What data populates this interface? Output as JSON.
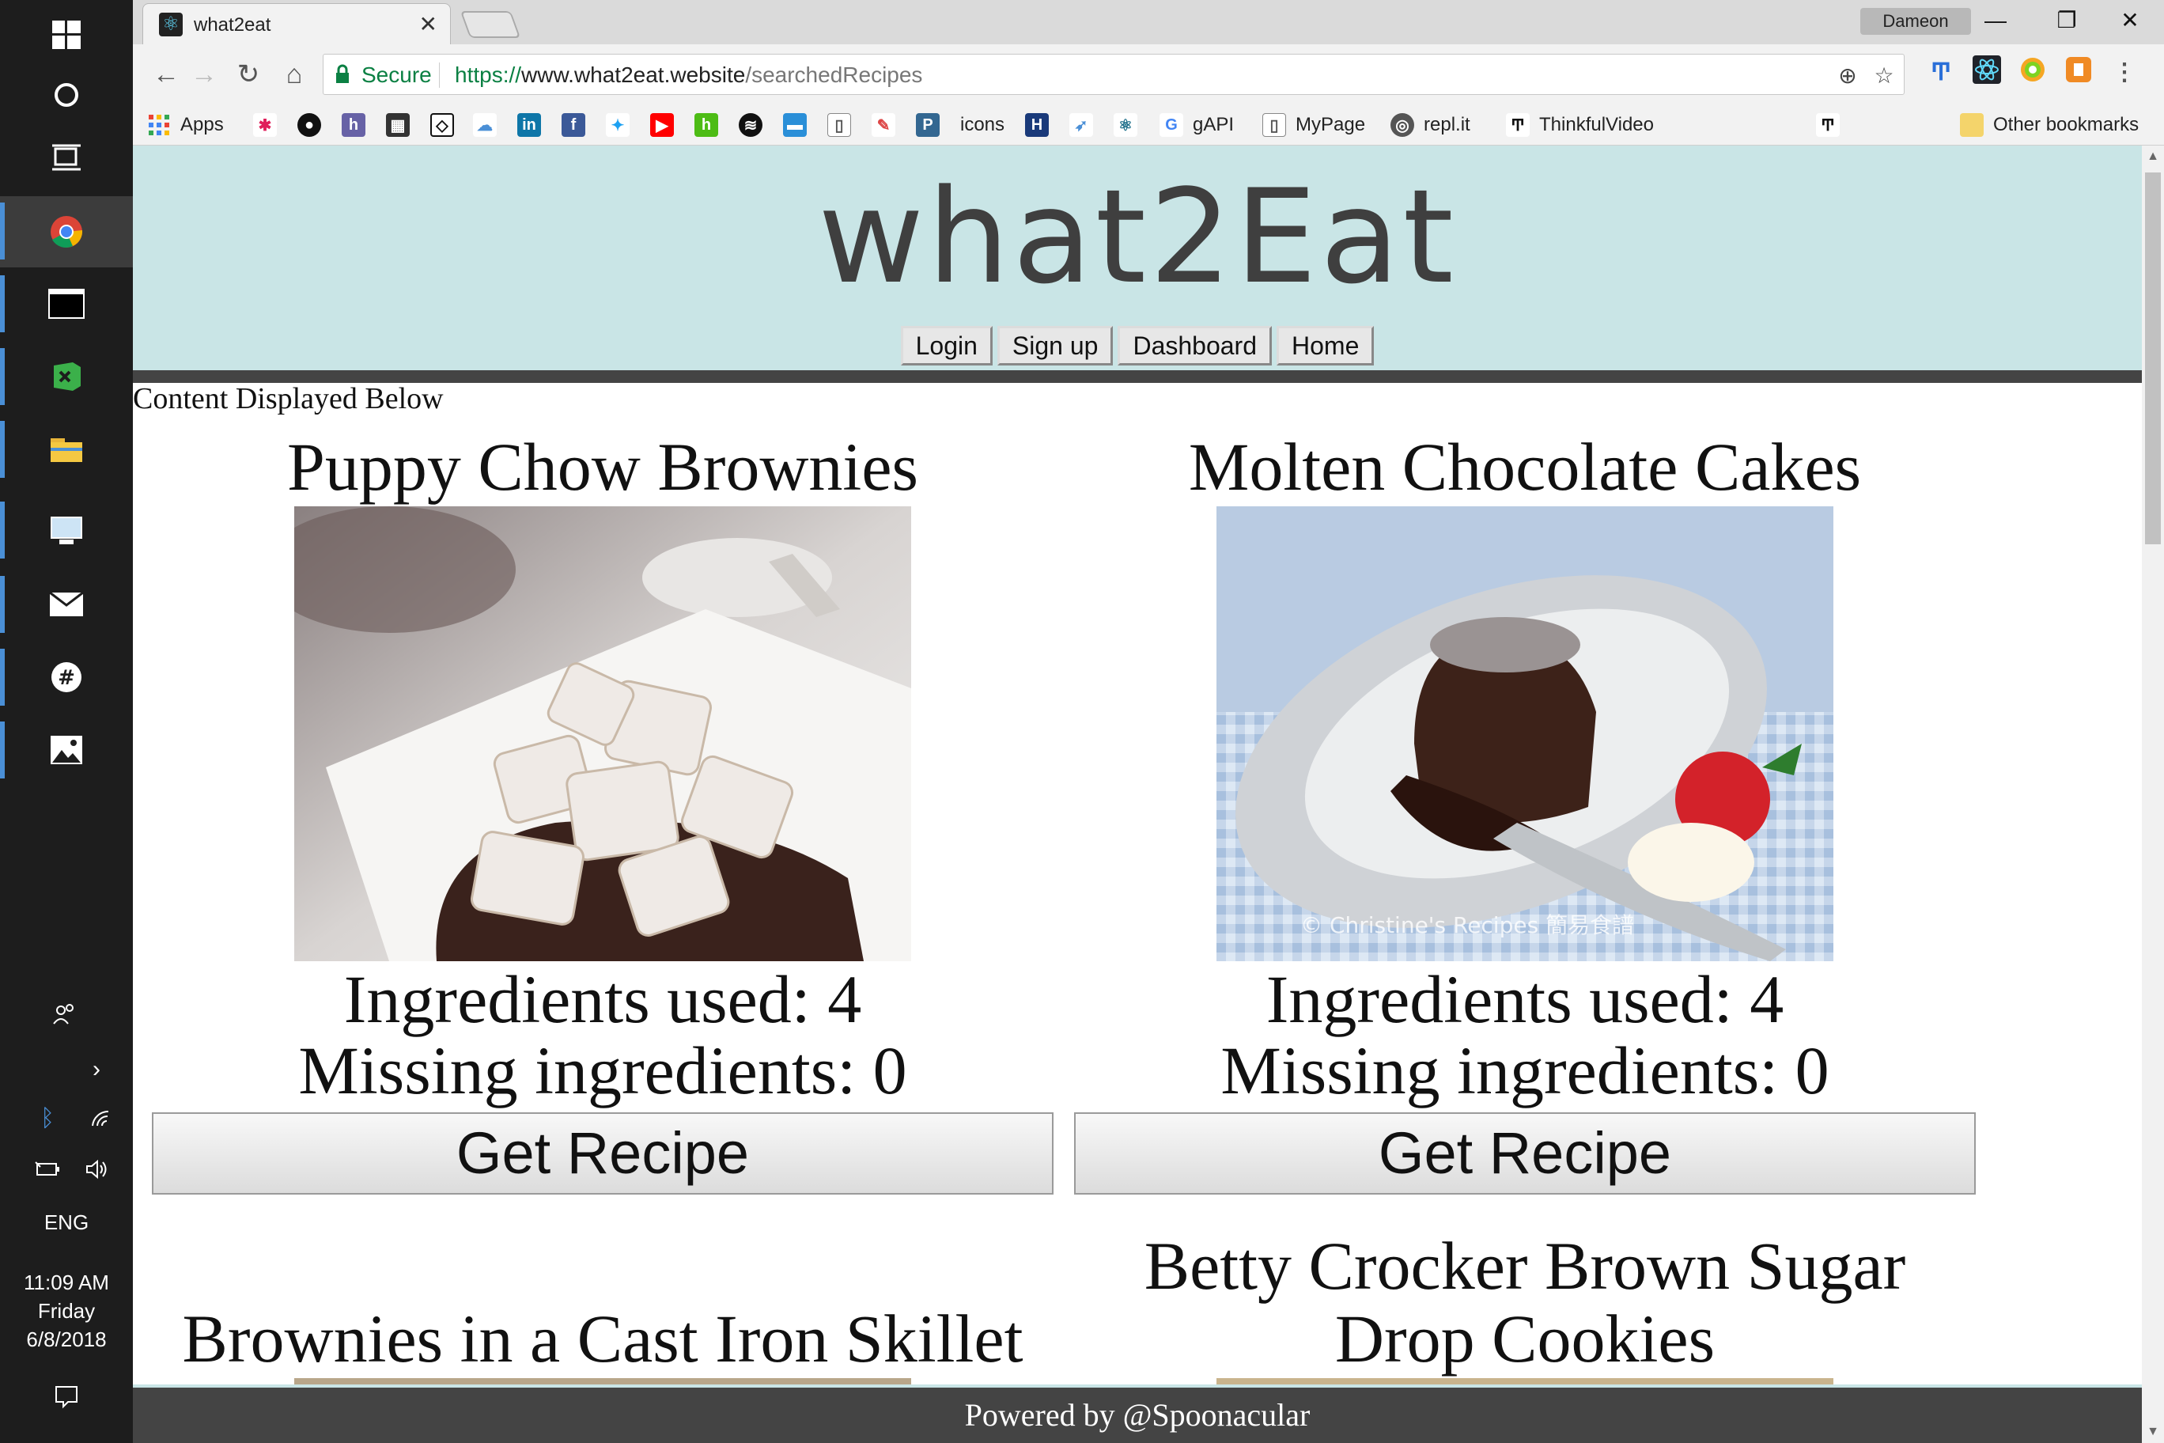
{
  "taskbar": {
    "clock": {
      "time": "11:09 AM",
      "day": "Friday",
      "date": "6/8/2018"
    },
    "language": "ENG"
  },
  "browser": {
    "tab_title": "what2eat",
    "profile_name": "Dameon",
    "secure_label": "Secure",
    "url": {
      "protocol": "https://",
      "host": "www.what2eat.website",
      "path": "/searchedRecipes"
    }
  },
  "bookmarks": {
    "apps": "Apps",
    "icons": "icons",
    "gapi": "gAPI",
    "mypage": "MyPage",
    "replit": "repl.it",
    "thinkful": "ThinkfulVideo",
    "other": "Other bookmarks"
  },
  "site": {
    "title": "what2Eat",
    "nav": [
      "Login",
      "Sign up",
      "Dashboard",
      "Home"
    ],
    "content_label": "Content Displayed Below",
    "footer": "Powered by @Spoonacular"
  },
  "recipes": [
    {
      "title": "Puppy Chow Brownies",
      "used": "Ingredients used: 4",
      "missing": "Missing ingredients: 0",
      "button": "Get Recipe"
    },
    {
      "title": "Molten Chocolate Cakes",
      "used": "Ingredients used: 4",
      "missing": "Missing ingredients: 0",
      "button": "Get Recipe",
      "watermark": "© Christine's Recipes 簡易食譜"
    },
    {
      "title": "Brownies in a Cast Iron Skillet"
    },
    {
      "title_line1": "Betty Crocker Brown Sugar",
      "title_line2": "Drop Cookies"
    }
  ],
  "colors": {
    "header_bg": "#c9e5e6",
    "header_rule": "#444444",
    "footer_bg": "#444444",
    "secure_green": "#0b8043"
  }
}
